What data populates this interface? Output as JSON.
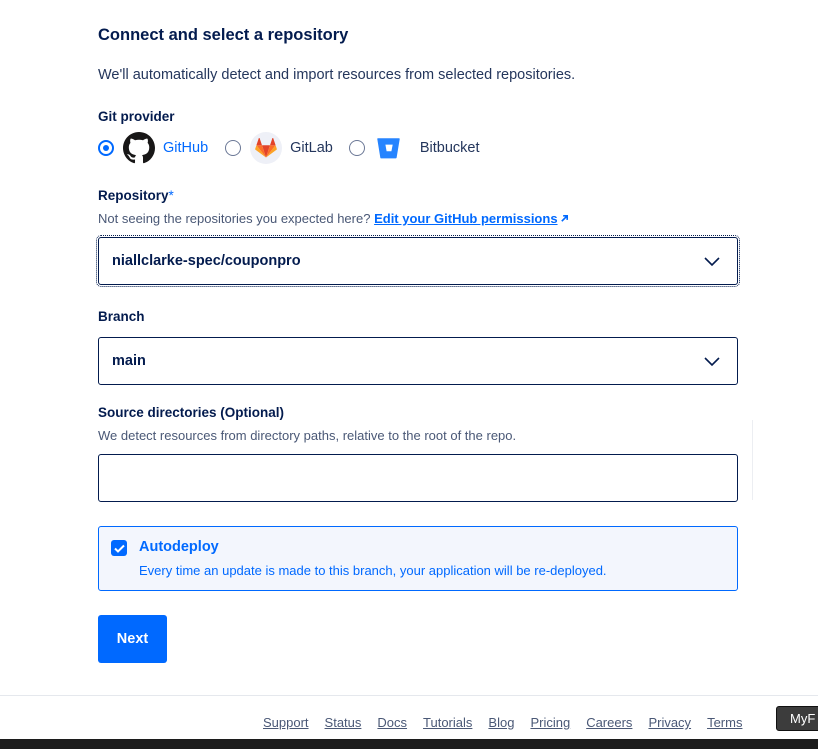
{
  "section": {
    "title": "Connect and select a repository",
    "subtitle": "We'll automatically detect and import resources from selected repositories."
  },
  "git_provider": {
    "label": "Git provider",
    "options": [
      {
        "label": "GitHub",
        "selected": true,
        "icon": "github-icon"
      },
      {
        "label": "GitLab",
        "selected": false,
        "icon": "gitlab-icon"
      },
      {
        "label": "Bitbucket",
        "selected": false,
        "icon": "bitbucket-icon"
      }
    ]
  },
  "repository": {
    "label": "Repository",
    "required_mark": "*",
    "help_text": "Not seeing the repositories you expected here?",
    "help_link": "Edit your GitHub permissions",
    "link_icon": "external-arrow-icon",
    "value": "niallclarke-spec/couponpro"
  },
  "branch": {
    "label": "Branch",
    "value": "main"
  },
  "source_directories": {
    "label": "Source directories (Optional)",
    "help_text": "We detect resources from directory paths, relative to the root of the repo.",
    "value": ""
  },
  "autodeploy": {
    "checked": true,
    "title": "Autodeploy",
    "description": "Every time an update is made to this branch, your application will be re-deployed."
  },
  "next_button": "Next",
  "footer": {
    "links": [
      "Support",
      "Status",
      "Docs",
      "Tutorials",
      "Blog",
      "Pricing",
      "Careers",
      "Privacy",
      "Terms"
    ],
    "floating_button": "MyF"
  },
  "colors": {
    "accent": "#0069ff",
    "text": "#031b4e",
    "muted": "#4a5876"
  }
}
